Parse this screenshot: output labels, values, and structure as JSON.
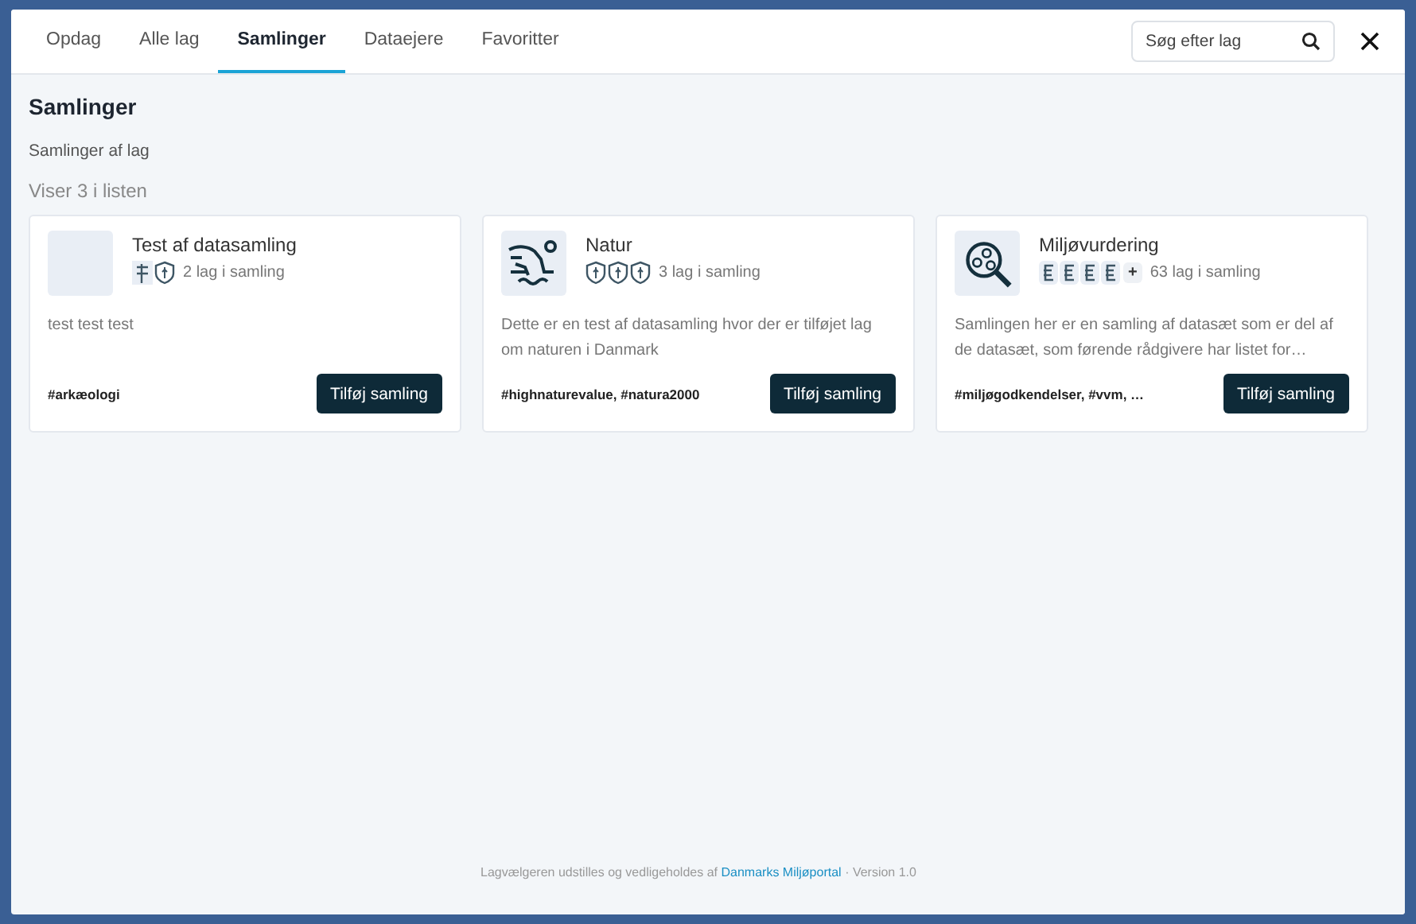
{
  "tabs": [
    {
      "label": "Opdag",
      "selected": false
    },
    {
      "label": "Alle lag",
      "selected": false
    },
    {
      "label": "Samlinger",
      "selected": true
    },
    {
      "label": "Dataejere",
      "selected": false
    },
    {
      "label": "Favoritter",
      "selected": false
    }
  ],
  "search": {
    "placeholder": "Søg efter lag"
  },
  "heading": "Samlinger",
  "subheading": "Samlinger af lag",
  "count": "Viser 3 i listen",
  "cards": [
    {
      "kind": "blank",
      "title": "Test af datasamling",
      "layer_icons": [
        {
          "kind": "sign"
        },
        {
          "kind": "shield"
        }
      ],
      "layers": "2 lag i samling",
      "description": "test test test",
      "tags": "#arkæologi",
      "button": "Tilføj samling"
    },
    {
      "kind": "nature",
      "title": "Natur",
      "layer_icons": [
        {
          "kind": "shield"
        },
        {
          "kind": "shield"
        },
        {
          "kind": "shield"
        }
      ],
      "layers": "3 lag i samling",
      "description": "Dette er en test af datasamling hvor der er tilføjet lag om naturen i Danmark",
      "tags": "#highnaturevalue, #natura2000",
      "button": "Tilføj samling"
    },
    {
      "kind": "search",
      "title": "Miljøvurdering",
      "layer_icons": [
        {
          "kind": "coin"
        },
        {
          "kind": "coin"
        },
        {
          "kind": "coin"
        },
        {
          "kind": "coin"
        }
      ],
      "more": "+",
      "layers": "63 lag i samling",
      "description": "Samlingen her er en samling af datasæt som er del af de datasæt, som førende rådgivere har listet for…",
      "tags": "#miljøgodkendelser, #vvm, …",
      "button": "Tilføj samling"
    }
  ],
  "footer": {
    "text": "Lagvælgeren udstilles og vedligeholdes af",
    "link": "Danmarks Miljøportal",
    "version": "· Version 1.0"
  }
}
